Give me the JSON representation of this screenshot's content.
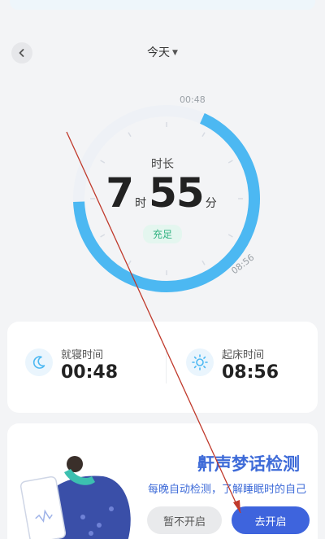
{
  "header": {
    "date_label": "今天"
  },
  "ring": {
    "duration_label": "时长",
    "hours": "7",
    "hours_unit": "时",
    "minutes": "55",
    "minutes_unit": "分",
    "quality_badge": "充足",
    "start_label": "00:48",
    "end_label": "08:56"
  },
  "times": {
    "bedtime_label": "就寝时间",
    "bedtime_value": "00:48",
    "waketime_label": "起床时间",
    "waketime_value": "08:56"
  },
  "promo": {
    "title": "鼾声梦话检测",
    "subtitle": "每晚自动检测，了解睡眠时的自己",
    "skip_label": "暂不开启",
    "enable_label": "去开启"
  },
  "colors": {
    "ring_progress": "#4cb8f2",
    "ring_track": "#eef1f6",
    "accent_blue": "#3e64dd",
    "badge_green": "#2fb280"
  },
  "icons": {
    "back": "chevron-left-icon",
    "bedtime": "moon-icon",
    "waketime": "sun-icon"
  }
}
